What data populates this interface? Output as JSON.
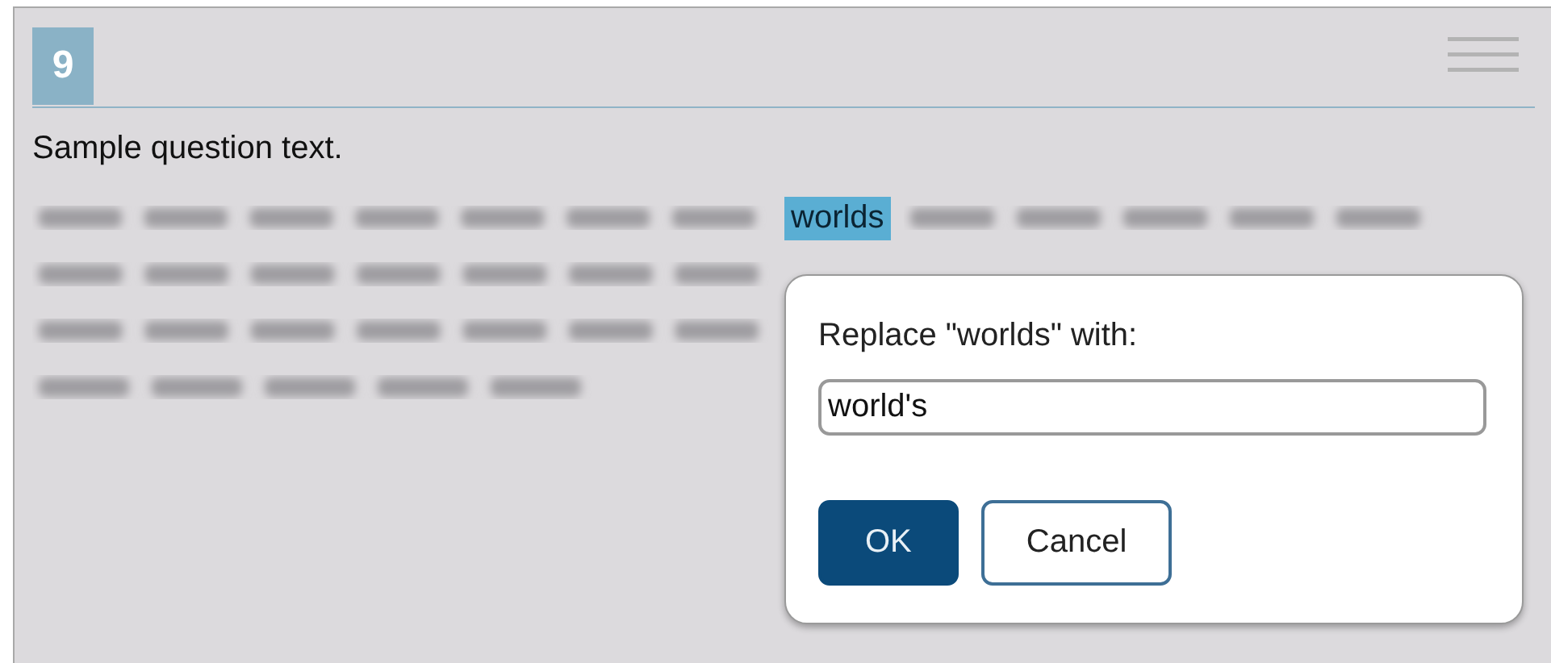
{
  "question": {
    "number": "9",
    "prompt": "Sample question text."
  },
  "passage": {
    "highlighted_word": "worlds"
  },
  "dialog": {
    "label": "Replace \"worlds\" with:",
    "value": "world's",
    "buttons": [
      {
        "label": "OK",
        "kind": "primary"
      },
      {
        "label": "Cancel",
        "kind": "secondary"
      }
    ]
  }
}
